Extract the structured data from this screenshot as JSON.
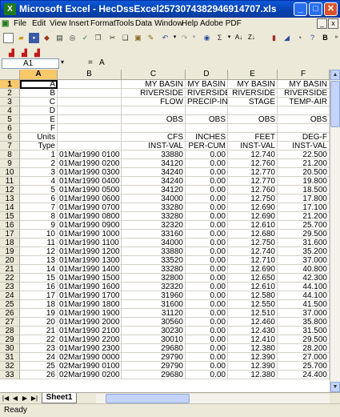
{
  "window": {
    "title": "Microsoft Excel - HecDssExcel2573074382946914707.xls",
    "app_icon": "excel-icon",
    "controls": [
      "_",
      "□",
      "✕"
    ]
  },
  "menu": [
    "File",
    "Edit",
    "View",
    "Insert",
    "Format",
    "Tools",
    "Data",
    "Window",
    "Help",
    "Adobe PDF"
  ],
  "mdi_controls": [
    "_",
    "x"
  ],
  "formula_bar": {
    "name_box": "A1",
    "fx": "=",
    "value": "A"
  },
  "columns": [
    "A",
    "B",
    "C",
    "D",
    "E",
    "F"
  ],
  "header_rows": [
    {
      "row": "1",
      "cells": [
        "A",
        "",
        "MY BASIN",
        "MY BASIN",
        "MY BASIN",
        "MY BASIN"
      ]
    },
    {
      "row": "2",
      "cells": [
        "B",
        "",
        "RIVERSIDE",
        "RIVERSIDE",
        "RIVERSIDE",
        "RIVERSIDE"
      ]
    },
    {
      "row": "3",
      "cells": [
        "C",
        "",
        "FLOW",
        "PRECIP-INC",
        "STAGE",
        "TEMP-AIR"
      ]
    },
    {
      "row": "4",
      "cells": [
        "D",
        "",
        "",
        "",
        "",
        ""
      ]
    },
    {
      "row": "5",
      "cells": [
        "E",
        "",
        "OBS",
        "OBS",
        "OBS",
        "OBS"
      ]
    },
    {
      "row": "6",
      "cells": [
        "F",
        "",
        "",
        "",
        "",
        ""
      ]
    },
    {
      "row": "6",
      "cells": [
        "Units",
        "",
        "CFS",
        "INCHES",
        "FEET",
        "DEG-F"
      ]
    },
    {
      "row": "7",
      "cells": [
        "Type",
        "",
        "INST-VAL",
        "PER-CUM",
        "INST-VAL",
        "INST-VAL"
      ]
    }
  ],
  "data_rows": [
    {
      "row": "8",
      "cells": [
        "1",
        "01Mar1990  0100",
        "33880",
        "0.00",
        "12.740",
        "22.500"
      ]
    },
    {
      "row": "9",
      "cells": [
        "2",
        "01Mar1990  0200",
        "34120",
        "0.00",
        "12.760",
        "21.200"
      ]
    },
    {
      "row": "10",
      "cells": [
        "3",
        "01Mar1990  0300",
        "34240",
        "0.00",
        "12.770",
        "20.500"
      ]
    },
    {
      "row": "11",
      "cells": [
        "4",
        "01Mar1990  0400",
        "34240",
        "0.00",
        "12.770",
        "19.800"
      ]
    },
    {
      "row": "12",
      "cells": [
        "5",
        "01Mar1990  0500",
        "34120",
        "0.00",
        "12.760",
        "18.500"
      ]
    },
    {
      "row": "13",
      "cells": [
        "6",
        "01Mar1990  0600",
        "34000",
        "0.00",
        "12.750",
        "17.800"
      ]
    },
    {
      "row": "14",
      "cells": [
        "7",
        "01Mar1990  0700",
        "33280",
        "0.00",
        "12.690",
        "17.100"
      ]
    },
    {
      "row": "15",
      "cells": [
        "8",
        "01Mar1990  0800",
        "33280",
        "0.00",
        "12.690",
        "21.200"
      ]
    },
    {
      "row": "16",
      "cells": [
        "9",
        "01Mar1990  0900",
        "32320",
        "0.00",
        "12.610",
        "25.700"
      ]
    },
    {
      "row": "17",
      "cells": [
        "10",
        "01Mar1990  1000",
        "33160",
        "0.00",
        "12.680",
        "29.500"
      ]
    },
    {
      "row": "18",
      "cells": [
        "11",
        "01Mar1990  1100",
        "34000",
        "0.00",
        "12.750",
        "31.600"
      ]
    },
    {
      "row": "19",
      "cells": [
        "12",
        "01Mar1990  1200",
        "33880",
        "0.00",
        "12.740",
        "35.200"
      ]
    },
    {
      "row": "20",
      "cells": [
        "13",
        "01Mar1990  1300",
        "33520",
        "0.00",
        "12.710",
        "37.000"
      ]
    },
    {
      "row": "21",
      "cells": [
        "14",
        "01Mar1990  1400",
        "33280",
        "0.00",
        "12.690",
        "40.800"
      ]
    },
    {
      "row": "22",
      "cells": [
        "15",
        "01Mar1990  1500",
        "32800",
        "0.00",
        "12.650",
        "42.300"
      ]
    },
    {
      "row": "23",
      "cells": [
        "16",
        "01Mar1990  1600",
        "32320",
        "0.00",
        "12.610",
        "44.100"
      ]
    },
    {
      "row": "24",
      "cells": [
        "17",
        "01Mar1990  1700",
        "31960",
        "0.00",
        "12.580",
        "44.100"
      ]
    },
    {
      "row": "25",
      "cells": [
        "18",
        "01Mar1990  1800",
        "31600",
        "0.00",
        "12.550",
        "41.500"
      ]
    },
    {
      "row": "26",
      "cells": [
        "19",
        "01Mar1990  1900",
        "31120",
        "0.00",
        "12.510",
        "37.000"
      ]
    },
    {
      "row": "27",
      "cells": [
        "20",
        "01Mar1990  2000",
        "30560",
        "0.00",
        "12.460",
        "35.800"
      ]
    },
    {
      "row": "28",
      "cells": [
        "21",
        "01Mar1990  2100",
        "30230",
        "0.00",
        "12.430",
        "31.500"
      ]
    },
    {
      "row": "29",
      "cells": [
        "22",
        "01Mar1990  2200",
        "30010",
        "0.00",
        "12.410",
        "29.500"
      ]
    },
    {
      "row": "30",
      "cells": [
        "23",
        "01Mar1990  2300",
        "29680",
        "0.00",
        "12.380",
        "28.200"
      ]
    },
    {
      "row": "31",
      "cells": [
        "24",
        "02Mar1990  0000",
        "29790",
        "0.00",
        "12.390",
        "27.000"
      ]
    },
    {
      "row": "32",
      "cells": [
        "25",
        "02Mar1990  0100",
        "29790",
        "0.00",
        "12.390",
        "25.700"
      ]
    },
    {
      "row": "33",
      "cells": [
        "26",
        "02Mar1990  0200",
        "29680",
        "0.00",
        "12.380",
        "24.400"
      ]
    }
  ],
  "sheet_tabs": [
    "Sheet1"
  ],
  "status": "Ready",
  "accent": {
    "title_bar": "#0a58d8",
    "selection_header": "#f9c869",
    "grid_line": "#d4d0c8"
  }
}
